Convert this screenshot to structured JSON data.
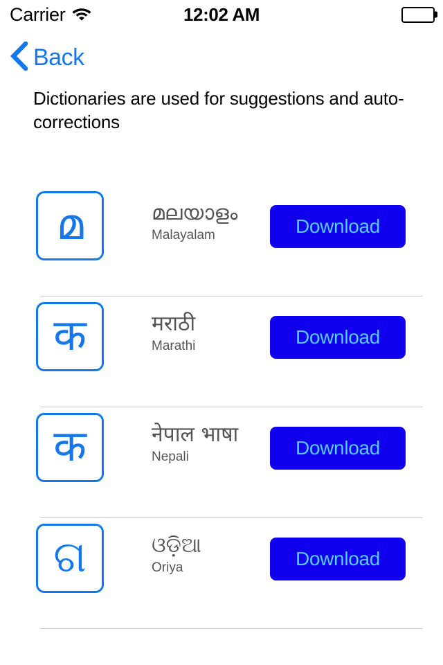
{
  "status_bar": {
    "carrier": "Carrier",
    "wifi_icon": "wifi-icon",
    "time": "12:02 AM",
    "battery_icon": "battery-full-icon"
  },
  "nav": {
    "back_label": "Back",
    "back_icon": "chevron-left-icon"
  },
  "description": "Dictionaries are used for suggestions and auto-corrections",
  "colors": {
    "ios_blue": "#1478ec",
    "button_background": "#1100ee",
    "button_text": "#55ccff",
    "separator": "#c8c7cc",
    "label_gray": "#555555"
  },
  "dictionaries": [
    {
      "icon_glyph": "മ",
      "icon_name": "malayalam-letter-icon",
      "native_name": "മലയാളം",
      "english_name": "Malayalam",
      "action_label": "Download"
    },
    {
      "icon_glyph": "क",
      "icon_name": "devanagari-letter-icon",
      "native_name": "मराठी",
      "english_name": "Marathi",
      "action_label": "Download"
    },
    {
      "icon_glyph": "क",
      "icon_name": "devanagari-letter-icon",
      "native_name": "नेपाल भाषा",
      "english_name": "Nepali",
      "action_label": "Download"
    },
    {
      "icon_glyph": "ଗ",
      "icon_name": "oriya-letter-icon",
      "native_name": "ଓଡ଼ିଆ",
      "english_name": "Oriya",
      "action_label": "Download"
    }
  ]
}
